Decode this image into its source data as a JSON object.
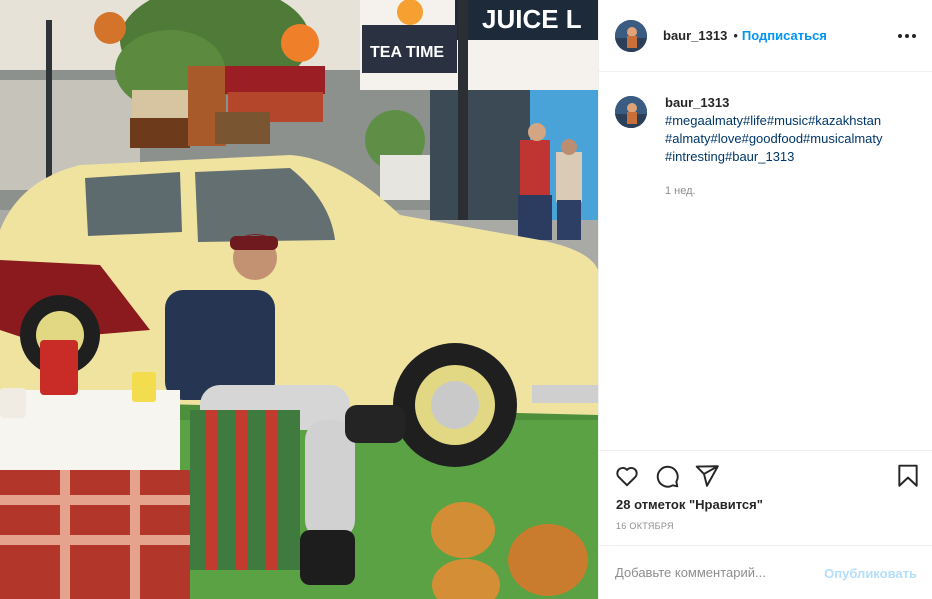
{
  "post": {
    "username": "baur_1313",
    "separator": "•",
    "follow_label": "Подписаться",
    "more_icon": "more-horizontal-icon",
    "caption_username": "baur_1313",
    "caption_tags": "#megaalmaty#life#music#kazakhstan #almaty#love#goodfood#musicalmaty #intresting#baur_1313",
    "caption_time": "1 нед.",
    "likes": "28 отметок \"Нравится\"",
    "date": "16 ОКТЯБРЯ",
    "comment_placeholder": "Добавьте комментарий...",
    "publish_label": "Опубликовать"
  },
  "photo": {
    "sign_juice": "JUICE L",
    "sign_tea": "TEA TIME",
    "sign_juice_lab": "JUICE LAB"
  },
  "icons": [
    "heart-icon",
    "comment-icon",
    "share-icon",
    "bookmark-icon"
  ],
  "colors": {
    "follow": "#0095f6",
    "tag": "#00376b",
    "muted": "#8e8e8e",
    "publish_disabled": "#b2dffc",
    "car_yellow": "#f0e3a0",
    "car_red": "#8a1a1e"
  }
}
